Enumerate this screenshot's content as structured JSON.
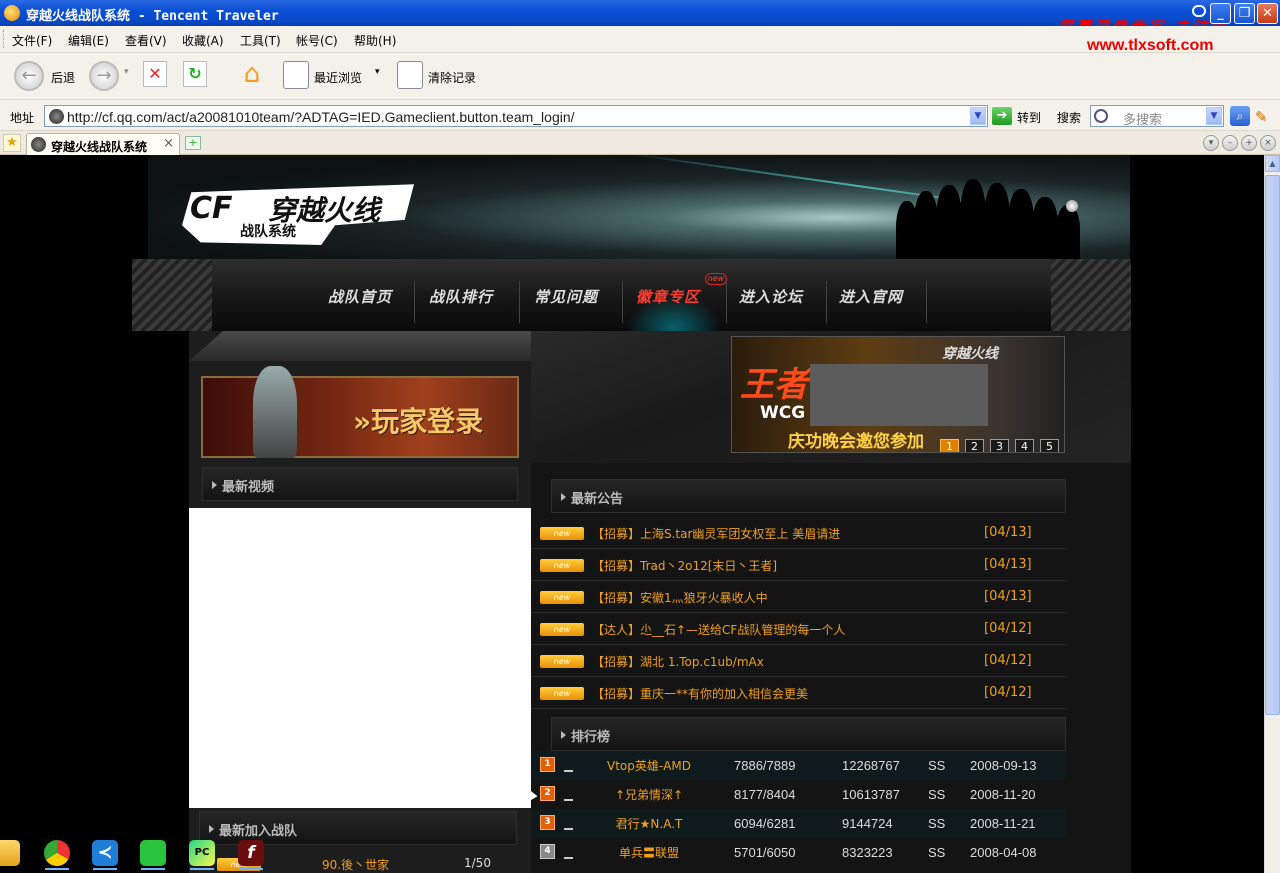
{
  "window": {
    "title": "穿越火线战队系统 - Tencent Traveler",
    "watermark_line1": "屏幕录像专家 未注册",
    "watermark_line2": "www.tlxsoft.com"
  },
  "menubar": {
    "items": [
      "文件(F)",
      "编辑(E)",
      "查看(V)",
      "收藏(A)",
      "工具(T)",
      "帐号(C)",
      "帮助(H)"
    ]
  },
  "toolbar": {
    "back_label": "后退",
    "recent_label": "最近浏览",
    "clear_label": "清除记录"
  },
  "addressbar": {
    "label": "地址",
    "url": "http://cf.qq.com/act/a20081010team/?ADTAG=IED.Gameclient.button.team_login/",
    "go_label": "转到",
    "search_label": "搜索",
    "search_placeholder": "多搜索"
  },
  "tabs": [
    {
      "title": "穿越火线战队系统"
    }
  ],
  "site": {
    "logo_cf": "CF",
    "logo_title": "穿越火线",
    "logo_subtitle": "战队系统",
    "nav": [
      "战队首页",
      "战队排行",
      "常见问题",
      "徽章专区",
      "进入论坛",
      "进入官网"
    ],
    "nav_active_index": 3,
    "nav_badge": "new",
    "login_label": "»玩家登录",
    "latest_video_heading": "最新视频",
    "latest_join_heading": "最新加入战队",
    "latest_join_row": {
      "name": "90.後丶世家",
      "count": "1/50"
    },
    "promo": {
      "big": "王者归来",
      "wcg": "WCG",
      "sub": "庆功晚会邀您参加",
      "cf_tag": "穿越火线",
      "pages": [
        "1",
        "2",
        "3",
        "4",
        "5"
      ],
      "active_page": 1
    },
    "news_heading": "最新公告",
    "news_badge": "new",
    "news": [
      {
        "title": "【招募】上海S.tar幽灵军团女权至上 美眉请进",
        "date": "[04/13]"
      },
      {
        "title": "【招募】Trad丶2o12[末日丶王者]",
        "date": "[04/13]"
      },
      {
        "title": "【招募】安徽1灬狼牙火暴收人中",
        "date": "[04/13]"
      },
      {
        "title": "【达人】尐__石↑—送给CF战队管理的每一个人",
        "date": "[04/12]"
      },
      {
        "title": "【招募】湖北 1.Top.c1ub/mAx",
        "date": "[04/12]"
      },
      {
        "title": "【招募】重庆一**有你的加入相信会更美",
        "date": "[04/12]"
      }
    ],
    "rank_heading": "排行榜",
    "rankings": [
      {
        "rank": "1",
        "name": "Vtop英雄-AMD",
        "members": "7886/7889",
        "score": "12268767",
        "level": "SS",
        "date": "2008-09-13"
      },
      {
        "rank": "2",
        "name": "↑兄弟情深↑",
        "members": "8177/8404",
        "score": "10613787",
        "level": "SS",
        "date": "2008-11-20"
      },
      {
        "rank": "3",
        "name": "君行★N.A.T",
        "members": "6094/6281",
        "score": "9144724",
        "level": "SS",
        "date": "2008-11-21"
      },
      {
        "rank": "4",
        "name": "单兵〓联盟",
        "members": "5701/6050",
        "score": "8323223",
        "level": "SS",
        "date": "2008-04-08"
      }
    ]
  },
  "taskbar_icons": [
    "folder-icon",
    "chrome-icon",
    "vscode-icon",
    "wechat-icon",
    "pycharm-icon",
    "flash-icon"
  ],
  "colors": {
    "titlebar": "#0a4fd6",
    "accent_orange": "#f0a020",
    "nav_active": "#ff3b2f",
    "watermark": "#e00000"
  }
}
